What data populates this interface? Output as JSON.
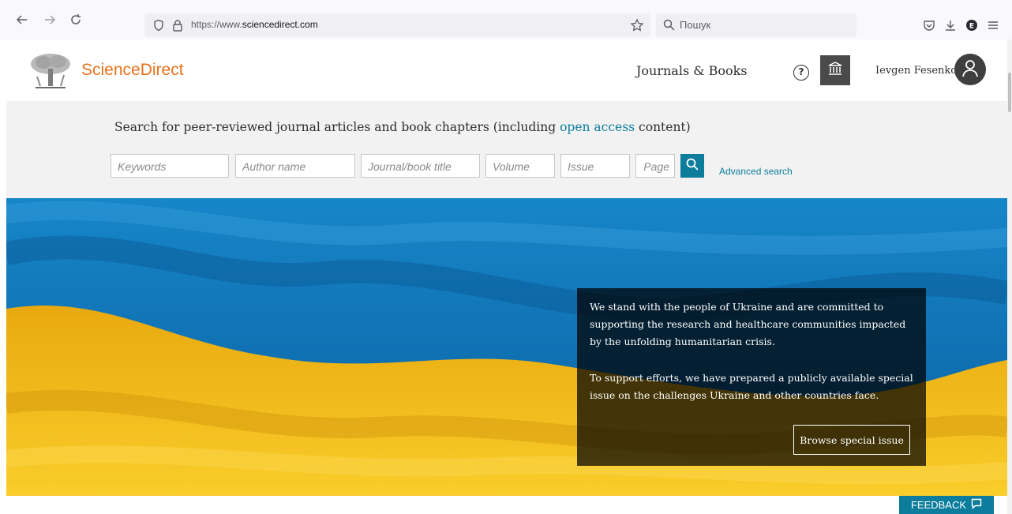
{
  "browser": {
    "url_prefix": "https://www.",
    "url_domain": "sciencedirect.com",
    "search_placeholder": "Пошук"
  },
  "header": {
    "brand": "ScienceDirect",
    "journals_link": "Journals & Books",
    "help_glyph": "?",
    "user_name": "Ievgen Fesenko"
  },
  "search": {
    "title_before": "Search for peer-reviewed journal articles and book chapters (including ",
    "title_link": "open access",
    "title_after": " content)",
    "keywords_placeholder": "Keywords",
    "author_placeholder": "Author name",
    "journal_placeholder": "Journal/book title",
    "volume_placeholder": "Volume",
    "issue_placeholder": "Issue",
    "page_placeholder": "Page",
    "advanced_link": "Advanced search"
  },
  "hero": {
    "paragraph_1": "We stand with the people of Ukraine and are committed to supporting the research and healthcare communities impacted by the unfolding humanitarian crisis.",
    "paragraph_2": "To support efforts, we have prepared a publicly available special issue on the challenges Ukraine and other countries face.",
    "button_label": "Browse special issue"
  },
  "feedback_label": "FEEDBACK",
  "colors": {
    "brand_orange": "#e9711c",
    "accent_teal": "#0c7d9d",
    "flag_blue": "#0a6fb8",
    "flag_yellow": "#f6c21b"
  }
}
